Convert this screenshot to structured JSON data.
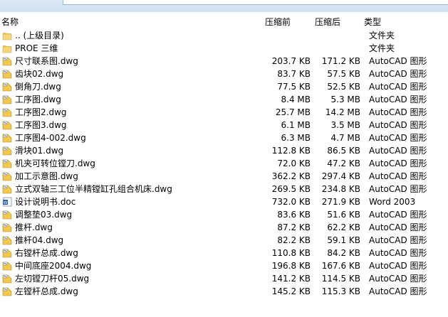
{
  "header": {
    "name": "名称",
    "before": "压缩前",
    "after": "压缩后",
    "type": "类型"
  },
  "rows": [
    {
      "name": ".. (上级目录)",
      "before": "",
      "after": "",
      "type": "文件夹",
      "icon": "folder"
    },
    {
      "name": "PROE 三维",
      "before": "",
      "after": "",
      "type": "文件夹",
      "icon": "folder"
    },
    {
      "name": "尺寸联系图.dwg",
      "before": "203.7 KB",
      "after": "171.2 KB",
      "type": "AutoCAD 图形",
      "icon": "dwg"
    },
    {
      "name": "齿块02.dwg",
      "before": "83.7 KB",
      "after": "57.5 KB",
      "type": "AutoCAD 图形",
      "icon": "dwg"
    },
    {
      "name": "倒角刀.dwg",
      "before": "77.5 KB",
      "after": "52.5 KB",
      "type": "AutoCAD 图形",
      "icon": "dwg"
    },
    {
      "name": "工序图.dwg",
      "before": "8.4 MB",
      "after": "5.3 MB",
      "type": "AutoCAD 图形",
      "icon": "dwg"
    },
    {
      "name": "工序图2.dwg",
      "before": "25.7 MB",
      "after": "14.2 MB",
      "type": "AutoCAD 图形",
      "icon": "dwg"
    },
    {
      "name": "工序图3.dwg",
      "before": "6.1 MB",
      "after": "3.5 MB",
      "type": "AutoCAD 图形",
      "icon": "dwg"
    },
    {
      "name": "工序图4-002.dwg",
      "before": "6.3 MB",
      "after": "4.7 MB",
      "type": "AutoCAD 图形",
      "icon": "dwg"
    },
    {
      "name": "滑块01.dwg",
      "before": "112.8 KB",
      "after": "86.5 KB",
      "type": "AutoCAD 图形",
      "icon": "dwg"
    },
    {
      "name": "机夹可转位镗刀.dwg",
      "before": "72.0 KB",
      "after": "47.2 KB",
      "type": "AutoCAD 图形",
      "icon": "dwg"
    },
    {
      "name": "加工示意图.dwg",
      "before": "362.2 KB",
      "after": "297.4 KB",
      "type": "AutoCAD 图形",
      "icon": "dwg"
    },
    {
      "name": "立式双轴三工位半精镗缸孔组合机床.dwg",
      "before": "269.5 KB",
      "after": "234.8 KB",
      "type": "AutoCAD 图形",
      "icon": "dwg"
    },
    {
      "name": "设计说明书.doc",
      "before": "732.0 KB",
      "after": "271.9 KB",
      "type": "Word 2003",
      "icon": "doc"
    },
    {
      "name": "调整垫03.dwg",
      "before": "83.6 KB",
      "after": "51.6 KB",
      "type": "AutoCAD 图形",
      "icon": "dwg"
    },
    {
      "name": "推杆.dwg",
      "before": "87.2 KB",
      "after": "62.2 KB",
      "type": "AutoCAD 图形",
      "icon": "dwg"
    },
    {
      "name": "推杆04.dwg",
      "before": "82.2 KB",
      "after": "59.1 KB",
      "type": "AutoCAD 图形",
      "icon": "dwg"
    },
    {
      "name": "右镗杆总成.dwg",
      "before": "110.8 KB",
      "after": "84.2 KB",
      "type": "AutoCAD 图形",
      "icon": "dwg"
    },
    {
      "name": "中间底座2004.dwg",
      "before": "196.8 KB",
      "after": "167.6 KB",
      "type": "AutoCAD 图形",
      "icon": "dwg"
    },
    {
      "name": "左切镗刀杆05.dwg",
      "before": "141.2 KB",
      "after": "114.5 KB",
      "type": "AutoCAD 图形",
      "icon": "dwg"
    },
    {
      "name": "左镗杆总成.dwg",
      "before": "145.2 KB",
      "after": "115.3 KB",
      "type": "AutoCAD 图形",
      "icon": "dwg"
    }
  ]
}
